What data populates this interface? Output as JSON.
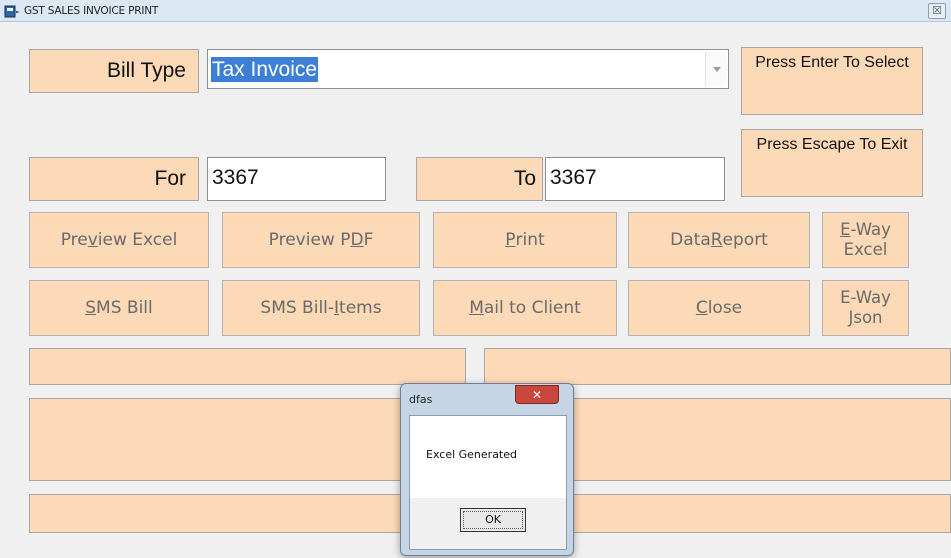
{
  "window": {
    "title": "GST SALES INVOICE PRINT",
    "close_glyph": "☒"
  },
  "form": {
    "bill_type_label": "Bill Type",
    "bill_type_value": "Tax Invoice",
    "for_label": "For",
    "for_value": "3367",
    "to_label": "To",
    "to_value": "3367",
    "hint_enter": "Press Enter To Select",
    "hint_escape": "Press Escape To Exit"
  },
  "buttons": {
    "preview_excel": {
      "pre": "Pre",
      "u": "v",
      "post": "iew Excel"
    },
    "preview_pdf": {
      "pre": "Preview P",
      "u": "D",
      "post": "F"
    },
    "print": {
      "pre": "",
      "u": "P",
      "post": "rint"
    },
    "data_report": {
      "pre": "Data ",
      "u": "R",
      "post": "eport"
    },
    "eway_excel": {
      "line1_u": "E",
      "line1_post": "-Way",
      "line2": "Excel"
    },
    "sms_bill": {
      "pre": "",
      "u": "S",
      "post": "MS Bill"
    },
    "sms_bill_items": {
      "pre": "SMS Bill-",
      "u": "I",
      "post": "tems"
    },
    "mail_to_client": {
      "pre": "",
      "u": "M",
      "post": "ail to Client"
    },
    "close": {
      "pre": "",
      "u": "C",
      "post": "lose"
    },
    "eway_json": {
      "line1": "E-Way",
      "line2_u": "J",
      "line2_post": "son"
    }
  },
  "dialog": {
    "title": "dfas",
    "message": "Excel Generated",
    "ok_label": "OK",
    "close_glyph": "✕"
  }
}
